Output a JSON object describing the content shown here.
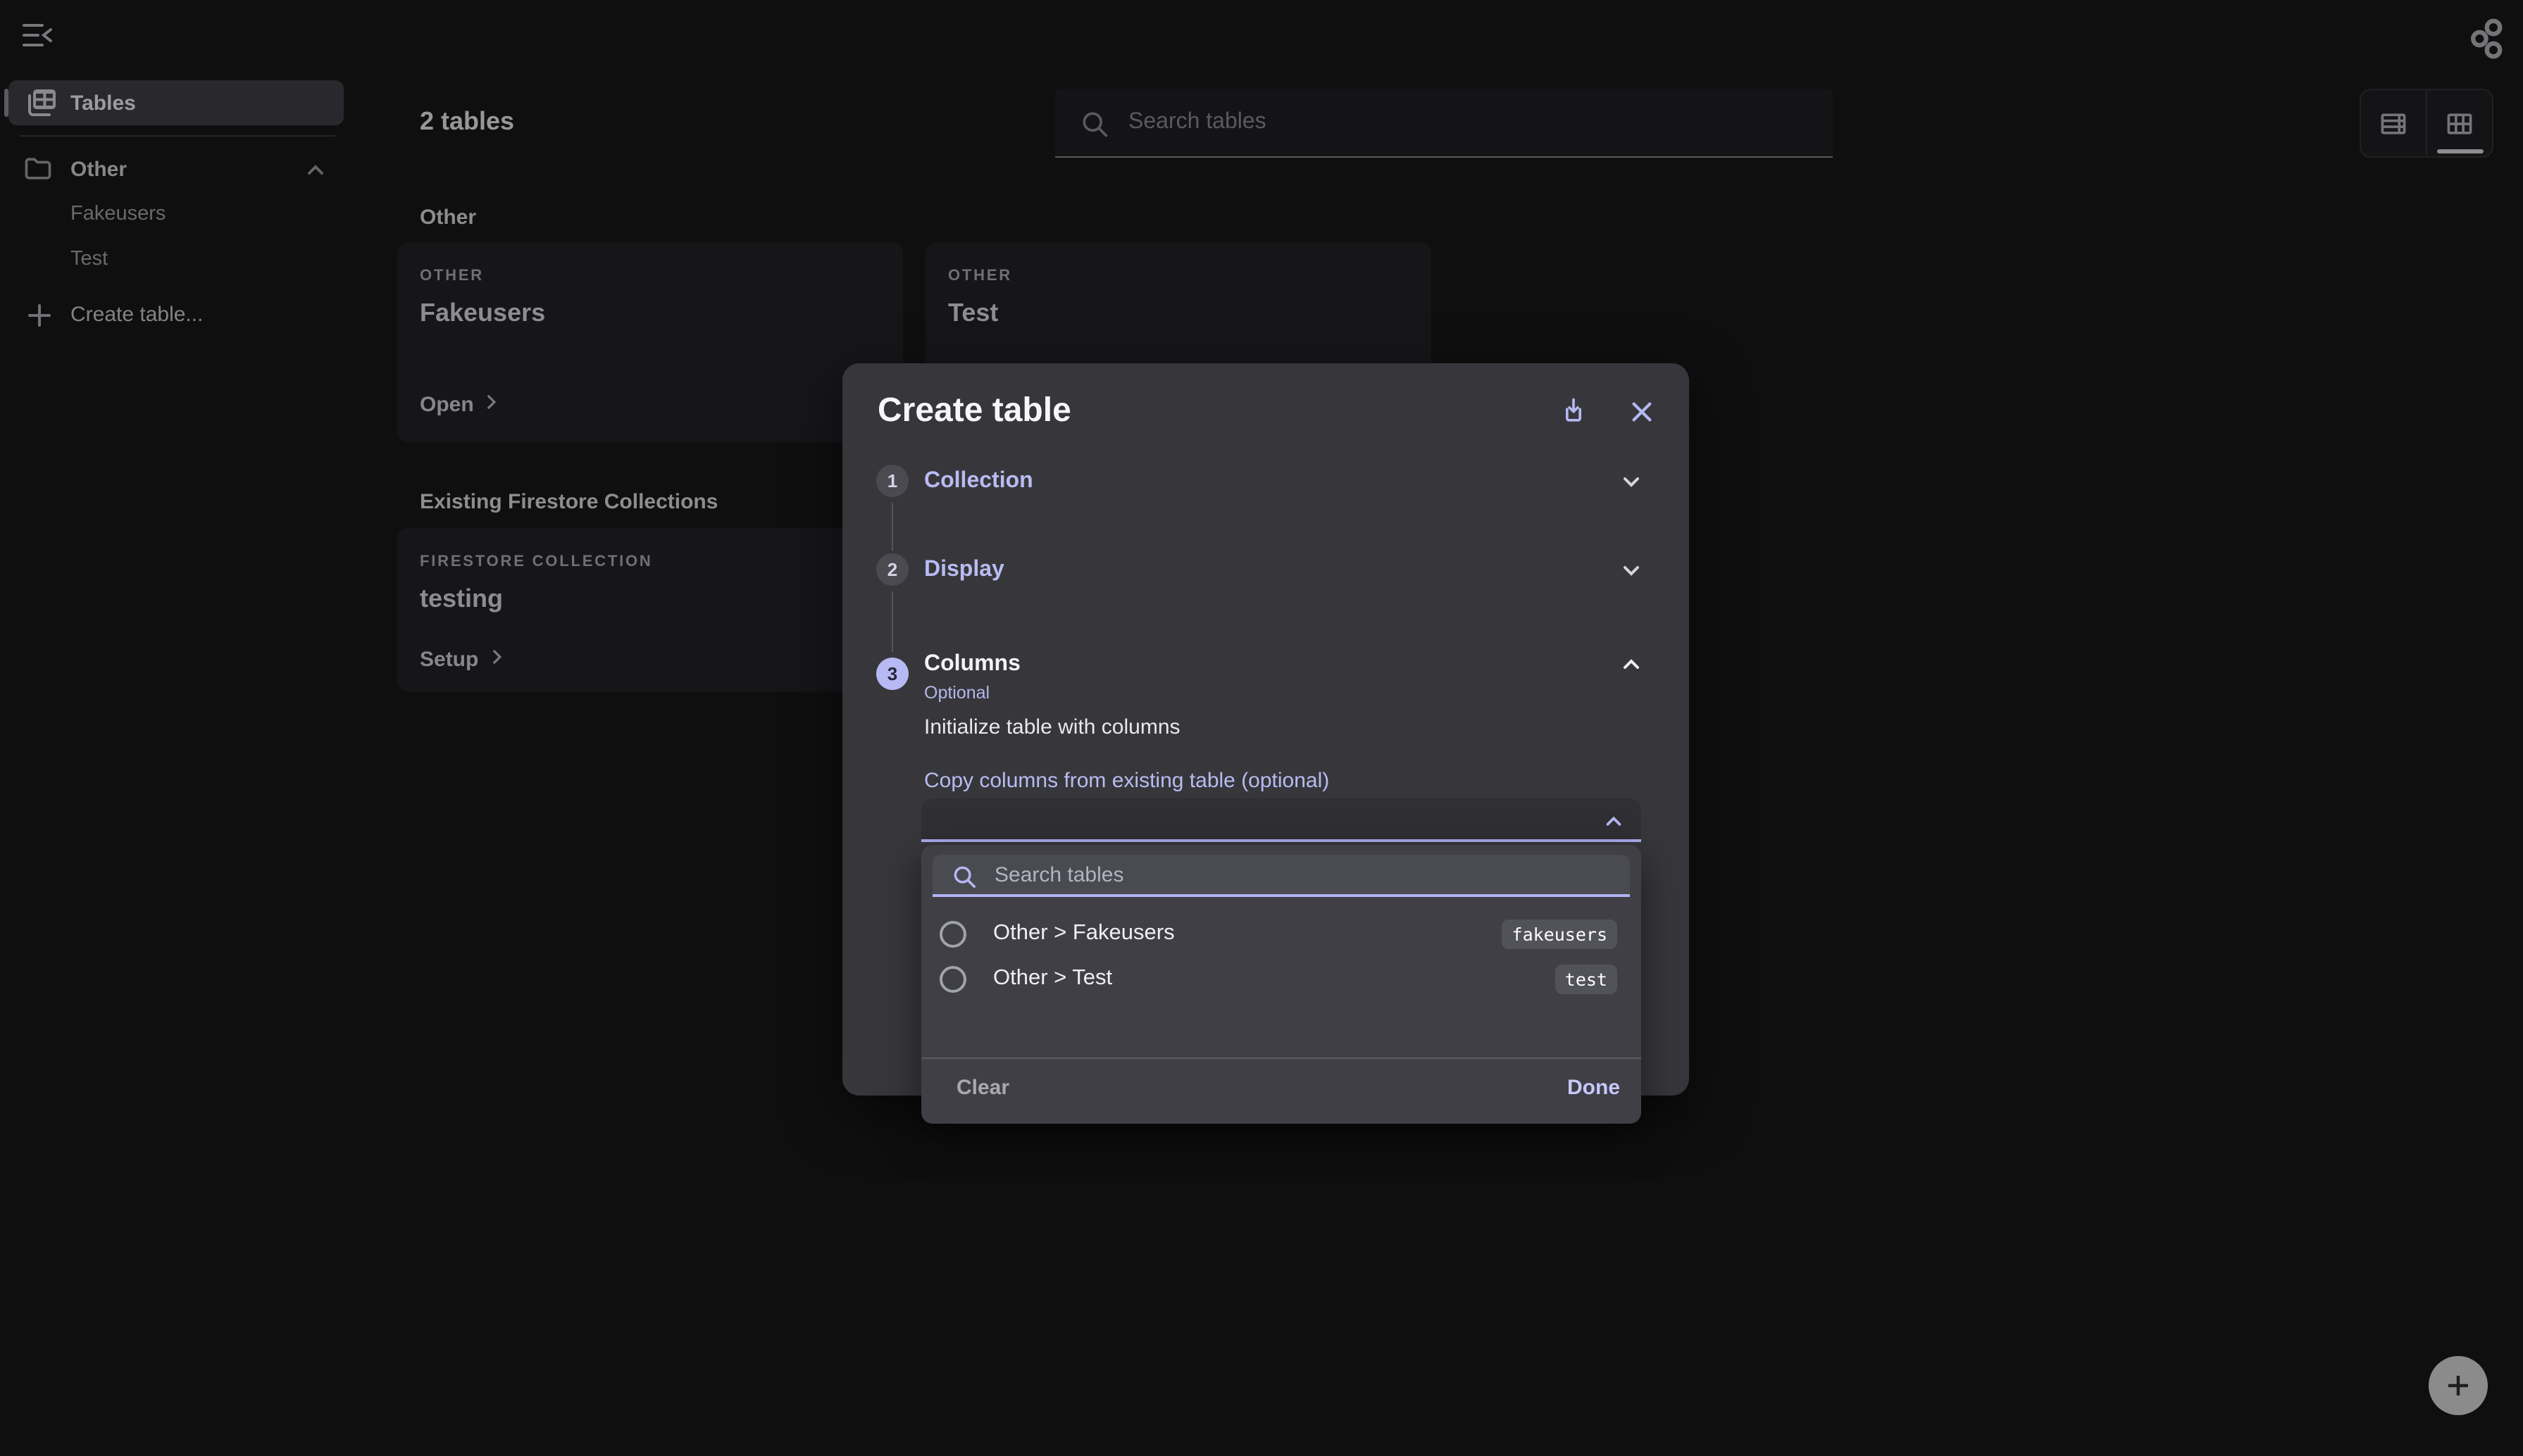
{
  "accent_color": "#b6b8f3",
  "sidebar": {
    "tables_label": "Tables",
    "folder": {
      "label": "Other",
      "children": [
        {
          "label": "Fakeusers"
        },
        {
          "label": "Test"
        }
      ]
    },
    "create_table_label": "Create table..."
  },
  "header": {
    "title": "2 tables",
    "search_placeholder": "Search tables"
  },
  "content": {
    "section_other": {
      "heading": "Other",
      "cards": [
        {
          "overline": "OTHER",
          "title": "Fakeusers",
          "action": "Open"
        },
        {
          "overline": "OTHER",
          "title": "Test"
        }
      ]
    },
    "section_firestore": {
      "heading": "Existing Firestore Collections",
      "cards": [
        {
          "overline": "FIRESTORE COLLECTION",
          "title": "testing",
          "action": "Setup"
        }
      ]
    }
  },
  "modal": {
    "title": "Create table",
    "steps": [
      {
        "number": "1",
        "label": "Collection"
      },
      {
        "number": "2",
        "label": "Display"
      },
      {
        "number": "3",
        "label": "Columns",
        "sublabel": "Optional"
      }
    ],
    "columns_section": {
      "description": "Initialize table with columns",
      "field_label": "Copy columns from existing table (optional)"
    }
  },
  "dropdown": {
    "search_placeholder": "Search tables",
    "options": [
      {
        "label": "Other > Fakeusers",
        "code": "fakeusers"
      },
      {
        "label": "Other > Test",
        "code": "test"
      }
    ],
    "clear_label": "Clear",
    "done_label": "Done"
  }
}
